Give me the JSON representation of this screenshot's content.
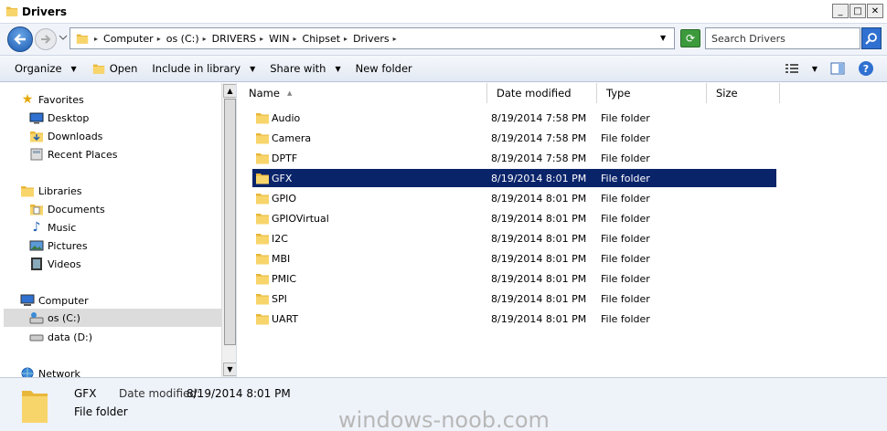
{
  "window": {
    "title": "Drivers"
  },
  "window_controls": {
    "minimize": "_",
    "maximize": "□",
    "close": "✕"
  },
  "address": {
    "crumbs": [
      "Computer",
      "os (C:)",
      "DRIVERS",
      "WIN",
      "Chipset",
      "Drivers"
    ]
  },
  "search": {
    "placeholder": "Search Drivers"
  },
  "toolbar": {
    "organize": "Organize",
    "open": "Open",
    "include_in_library": "Include in library",
    "share_with": "Share with",
    "new_folder": "New folder"
  },
  "nav": {
    "favorites": "Favorites",
    "desktop": "Desktop",
    "downloads": "Downloads",
    "recent_places": "Recent Places",
    "libraries": "Libraries",
    "documents": "Documents",
    "music": "Music",
    "pictures": "Pictures",
    "videos": "Videos",
    "computer": "Computer",
    "os_c": "os (C:)",
    "data_d": "data (D:)",
    "network": "Network"
  },
  "columns": {
    "name": "Name",
    "date_modified": "Date modified",
    "type": "Type",
    "size": "Size"
  },
  "files": [
    {
      "name": "Audio",
      "date": "8/19/2014 7:58 PM",
      "type": "File folder"
    },
    {
      "name": "Camera",
      "date": "8/19/2014 7:58 PM",
      "type": "File folder"
    },
    {
      "name": "DPTF",
      "date": "8/19/2014 7:58 PM",
      "type": "File folder"
    },
    {
      "name": "GFX",
      "date": "8/19/2014 8:01 PM",
      "type": "File folder"
    },
    {
      "name": "GPIO",
      "date": "8/19/2014 8:01 PM",
      "type": "File folder"
    },
    {
      "name": "GPIOVirtual",
      "date": "8/19/2014 8:01 PM",
      "type": "File folder"
    },
    {
      "name": "I2C",
      "date": "8/19/2014 8:01 PM",
      "type": "File folder"
    },
    {
      "name": "MBI",
      "date": "8/19/2014 8:01 PM",
      "type": "File folder"
    },
    {
      "name": "PMIC",
      "date": "8/19/2014 8:01 PM",
      "type": "File folder"
    },
    {
      "name": "SPI",
      "date": "8/19/2014 8:01 PM",
      "type": "File folder"
    },
    {
      "name": "UART",
      "date": "8/19/2014 8:01 PM",
      "type": "File folder"
    }
  ],
  "details": {
    "name": "GFX",
    "modified_label": "Date modified:",
    "modified_value": "8/19/2014 8:01 PM",
    "type": "File folder"
  },
  "watermark": "windows-noob.com",
  "colors": {
    "selection": "#0a246a",
    "folder": "#f5c842"
  }
}
